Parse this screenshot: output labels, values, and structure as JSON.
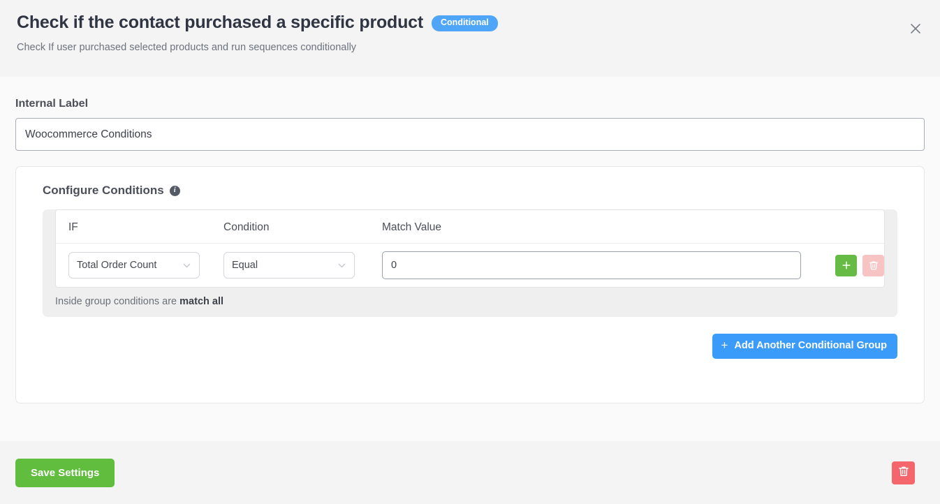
{
  "header": {
    "title": "Check if the contact purchased a specific product",
    "badge": "Conditional",
    "subtitle": "Check If user purchased selected products and run sequences conditionally",
    "close_icon": "close-icon"
  },
  "internal_label": {
    "label": "Internal Label",
    "value": "Woocommerce Conditions",
    "placeholder": "Internal Label"
  },
  "conditions": {
    "heading": "Configure Conditions",
    "info_icon": "info-icon",
    "columns": {
      "if": "IF",
      "condition": "Condition",
      "match_value": "Match Value"
    },
    "rows": [
      {
        "if": "Total Order Count",
        "condition": "Equal",
        "match_value": "0",
        "match_placeholder": "",
        "add_icon": "plus-icon",
        "delete_icon": "trash-icon"
      }
    ],
    "group_note_prefix": "Inside group conditions are ",
    "group_note_strong": "match all",
    "add_group_button": "Add Another Conditional Group",
    "add_group_plus": "+"
  },
  "footer": {
    "save_label": "Save Settings",
    "delete_icon": "trash-icon"
  },
  "colors": {
    "accent_blue": "#3b9bfb",
    "badge_blue": "#4fa5f8",
    "green": "#60bd3e",
    "green_small": "#66bb45",
    "pink": "#f7c3c3",
    "red": "#f4666c",
    "header_bg": "#f4f4f5",
    "body_bg": "#fafafa",
    "group_bg": "#efefef"
  }
}
